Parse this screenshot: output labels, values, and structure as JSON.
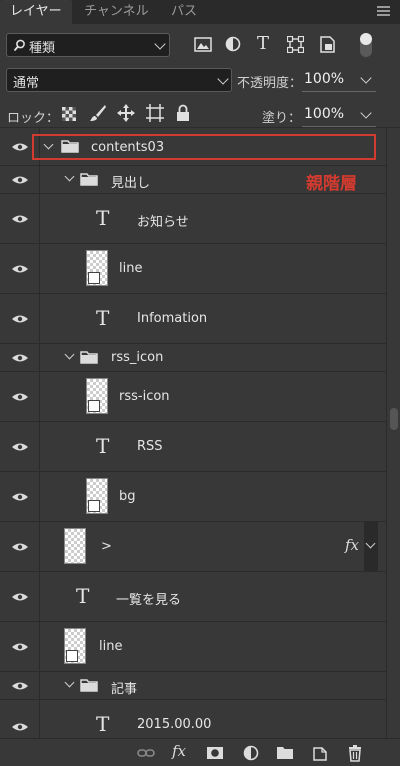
{
  "tabs": [
    {
      "label": "レイヤー",
      "active": true
    },
    {
      "label": "チャンネル",
      "active": false
    },
    {
      "label": "パス",
      "active": false
    }
  ],
  "filter": {
    "label": "種類"
  },
  "blend": {
    "mode": "通常",
    "opacity_label": "不透明度：",
    "opacity_value": "100%",
    "lock_label": "ロック：",
    "fill_label": "塗り：",
    "fill_value": "100%"
  },
  "annotation": "親階層",
  "accent_color": "#d33a30",
  "layers": [
    {
      "name": "contents03",
      "kind": "group"
    },
    {
      "name": "見出し",
      "kind": "group"
    },
    {
      "name": "お知らせ",
      "kind": "text"
    },
    {
      "name": "line",
      "kind": "shape"
    },
    {
      "name": "Infomation",
      "kind": "text"
    },
    {
      "name": "rss_icon",
      "kind": "group"
    },
    {
      "name": "rss-icon",
      "kind": "smart-object"
    },
    {
      "name": "RSS",
      "kind": "text"
    },
    {
      "name": "bg",
      "kind": "shape"
    },
    {
      "name": ">",
      "kind": "pixel",
      "fx": "fx"
    },
    {
      "name": "一覧を見る",
      "kind": "text"
    },
    {
      "name": "line",
      "kind": "shape"
    },
    {
      "name": "記事",
      "kind": "group"
    },
    {
      "name": "2015.00.00",
      "kind": "text"
    }
  ],
  "text_layer_glyph": "T"
}
